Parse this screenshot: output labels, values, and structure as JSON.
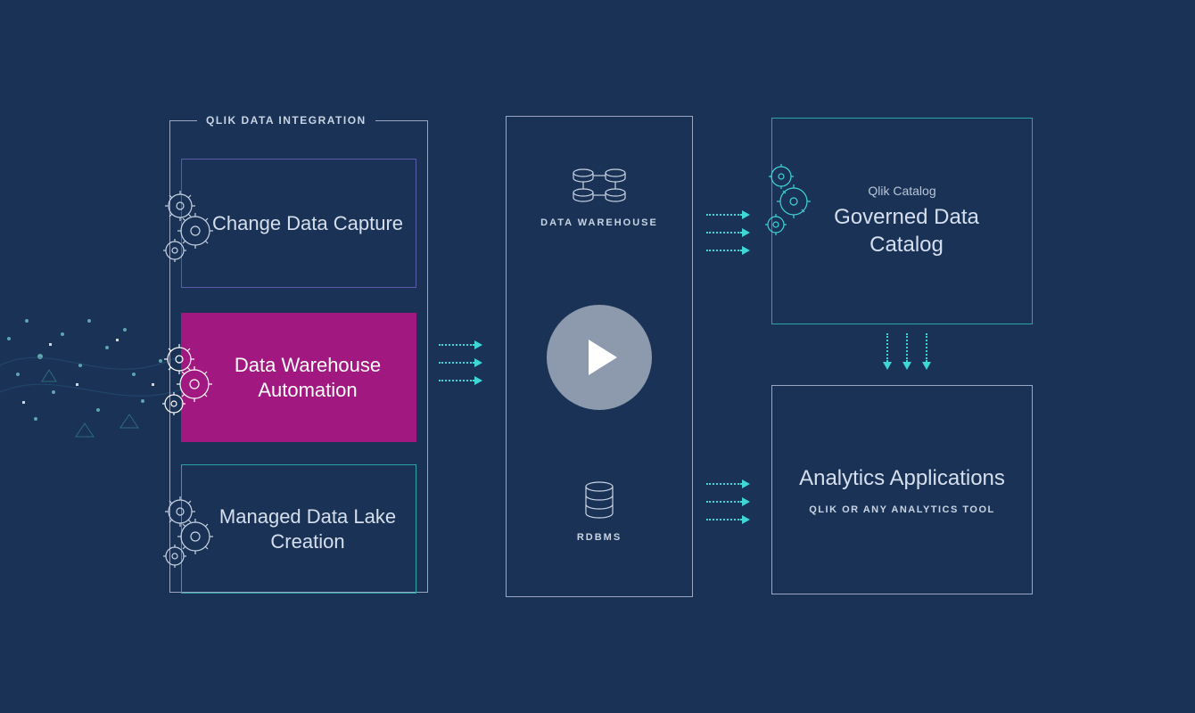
{
  "integration": {
    "header": "QLIK DATA INTEGRATION",
    "cards": [
      {
        "title": "Change Data Capture"
      },
      {
        "title": "Data Warehouse Automation"
      },
      {
        "title": "Managed Data Lake Creation"
      }
    ]
  },
  "middle": {
    "top_label": "DATA WAREHOUSE",
    "bottom_label": "RDBMS"
  },
  "catalog": {
    "sub": "Qlik Catalog",
    "title": "Governed Data Catalog"
  },
  "analytics": {
    "title": "Analytics Applications",
    "sub": "QLIK OR ANY ANALYTICS TOOL"
  },
  "colors": {
    "background": "#1a3256",
    "accent_teal": "#2aa4a4",
    "accent_purple": "#5b5aad",
    "highlight_magenta": "#a01880"
  }
}
